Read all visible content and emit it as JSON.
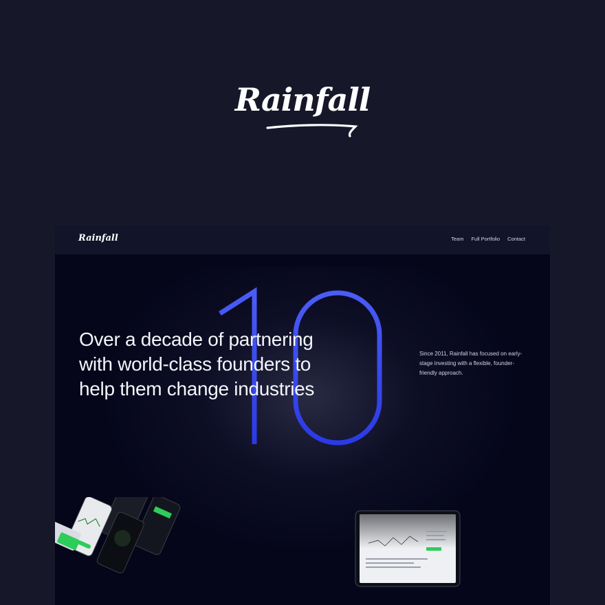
{
  "brand": {
    "name": "Rainfall"
  },
  "nav": {
    "logo": "Rainfall",
    "links": [
      "Team",
      "Full Portfolio",
      "Contact"
    ]
  },
  "hero": {
    "big_number": "10",
    "headline_lines": [
      "Over a decade of partnering",
      "with world-class founders to",
      "help them change industries"
    ],
    "blurb_lines": [
      "Since 2011, Rainfall has focused on early-",
      "stage investing with a flexible, founder-",
      "friendly approach."
    ]
  },
  "colors": {
    "page_bg": "#161829",
    "frame_bg": "#05061a",
    "accent_blue": "#3446ee",
    "accent_green": "#2ecc5a"
  }
}
